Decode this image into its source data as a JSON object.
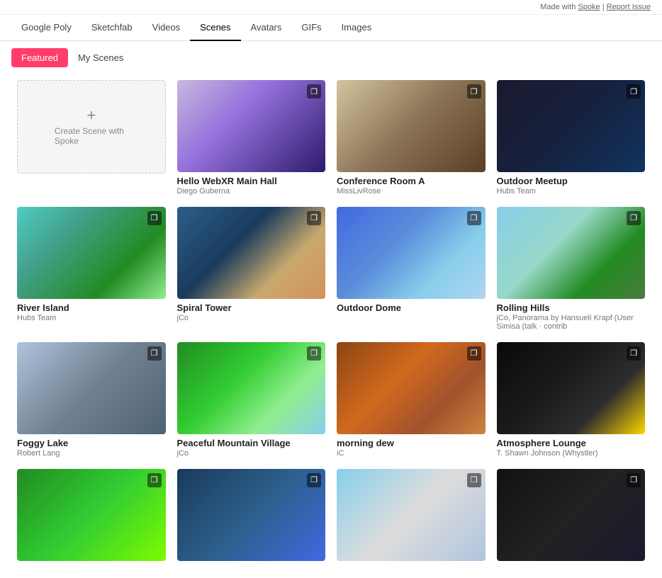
{
  "topbar": {
    "made_with": "Made with",
    "spoke_link": "Spoke",
    "separator": "|",
    "report_link": "Report Issue"
  },
  "nav": {
    "items": [
      {
        "id": "google-poly",
        "label": "Google Poly",
        "active": false
      },
      {
        "id": "sketchfab",
        "label": "Sketchfab",
        "active": false
      },
      {
        "id": "videos",
        "label": "Videos",
        "active": false
      },
      {
        "id": "scenes",
        "label": "Scenes",
        "active": true
      },
      {
        "id": "avatars",
        "label": "Avatars",
        "active": false
      },
      {
        "id": "gifs",
        "label": "GIFs",
        "active": false
      },
      {
        "id": "images",
        "label": "Images",
        "active": false
      }
    ]
  },
  "tabs": {
    "featured": "Featured",
    "my_scenes": "My Scenes"
  },
  "create_scene": {
    "plus": "+",
    "label": "Create Scene with Spoke"
  },
  "scenes": [
    {
      "id": "hello-webxr",
      "title": "Hello WebXR Main Hall",
      "author": "Diego Guberna",
      "bg": "bg-webxr"
    },
    {
      "id": "conference-room",
      "title": "Conference Room A",
      "author": "MissLivRose",
      "bg": "bg-conference"
    },
    {
      "id": "outdoor-meetup",
      "title": "Outdoor Meetup",
      "author": "Hubs Team",
      "bg": "bg-outdoor-meetup"
    },
    {
      "id": "river-island",
      "title": "River Island",
      "author": "Hubs Team",
      "bg": "bg-river-island"
    },
    {
      "id": "spiral-tower",
      "title": "Spiral Tower",
      "author": "jCo",
      "bg": "bg-spiral-tower"
    },
    {
      "id": "outdoor-dome",
      "title": "Outdoor Dome",
      "author": "",
      "bg": "bg-outdoor-dome"
    },
    {
      "id": "rolling-hills",
      "title": "Rolling Hills",
      "author": "jCo, Panorama by Hansueli Krapf (User Simisa (talk · contrib",
      "bg": "bg-rolling-hills"
    },
    {
      "id": "foggy-lake",
      "title": "Foggy Lake",
      "author": "Robert Lang",
      "bg": "bg-foggy-lake"
    },
    {
      "id": "peaceful-mountain",
      "title": "Peaceful Mountain Village",
      "author": "jCo",
      "bg": "bg-mountain-village"
    },
    {
      "id": "morning-dew",
      "title": "morning dew",
      "author": "iC",
      "bg": "bg-morning-dew"
    },
    {
      "id": "atmosphere-lounge",
      "title": "Atmosphere Lounge",
      "author": "T. Shawn Johnson (Whystler)",
      "bg": "bg-atmosphere-lounge"
    },
    {
      "id": "bottom1",
      "title": "",
      "author": "",
      "bg": "bg-bottom1"
    },
    {
      "id": "bottom2",
      "title": "",
      "author": "",
      "bg": "bg-bottom2"
    },
    {
      "id": "bottom3",
      "title": "",
      "author": "",
      "bg": "bg-bottom3"
    },
    {
      "id": "bottom4",
      "title": "",
      "author": "",
      "bg": "bg-bottom4"
    }
  ],
  "copy_icon": "❐"
}
